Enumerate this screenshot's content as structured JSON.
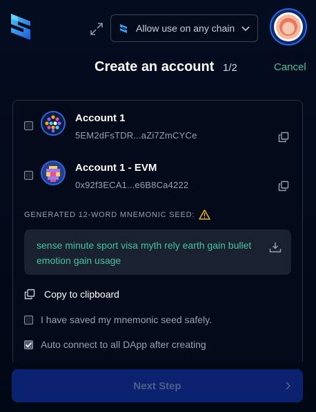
{
  "header": {
    "chain_select_label": "Allow use on any chain",
    "title": "Create an account",
    "step": "1/2",
    "cancel_label": "Cancel"
  },
  "accounts": [
    {
      "name": "Account 1",
      "address": "5EM2dFsTDR...aZi7ZmCYCe",
      "checked": false
    },
    {
      "name": "Account 1 - EVM",
      "address": "0x92f3ECA1...e6B8Ca4222",
      "checked": false
    }
  ],
  "seed": {
    "label": "GENERATED 12-WORD MNEMONIC SEED:",
    "phrase": "sense minute sport visa myth rely earth gain bullet emotion gain usage"
  },
  "copy_label": "Copy to clipboard",
  "options": [
    {
      "label": "I have saved my mnemonic seed safely.",
      "checked": false
    },
    {
      "label": "Auto connect to all DApp after creating",
      "checked": true
    }
  ],
  "next_label": "Next Step",
  "colors": {
    "accent": "#42c59a",
    "primary_button": "#0a2270",
    "background": "#040a1a"
  },
  "icons": [
    "logo-icon",
    "expand-icon",
    "chain-icon",
    "chevron-down-icon",
    "copy-icon",
    "warning-icon",
    "download-icon",
    "chevron-right-icon"
  ]
}
